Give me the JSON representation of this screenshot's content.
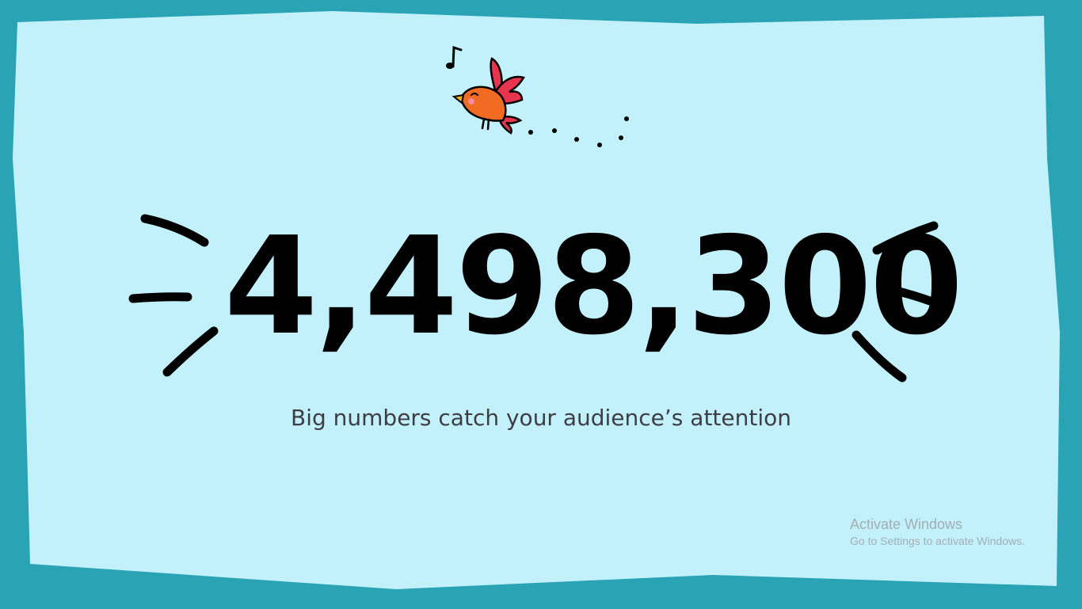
{
  "slide": {
    "big_number": "4,498,300",
    "subtitle": "Big numbers catch your audience’s attention"
  },
  "watermark": {
    "title": "Activate Windows",
    "message": "Go to Settings to activate Windows."
  },
  "colors": {
    "background": "#c2f1fc",
    "frame": "#2aa3b5",
    "text": "#000000",
    "subtitle": "#3d3d44",
    "bird_body": "#f26b23",
    "bird_wing": "#e8344e",
    "watermark": "#a3aeb5"
  },
  "icons": {
    "illustration": "bird-icon",
    "note": "music-note-icon"
  }
}
